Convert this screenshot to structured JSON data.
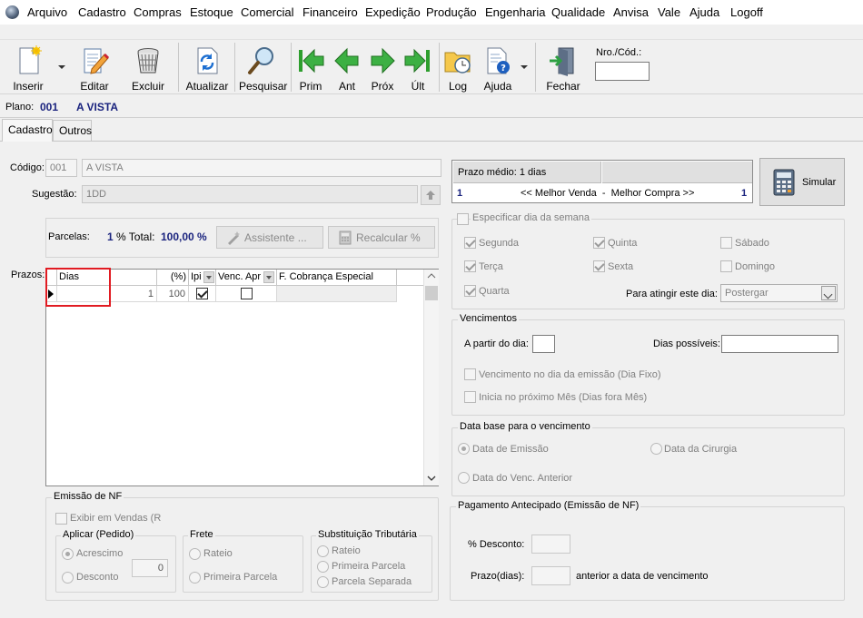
{
  "menu": [
    "Arquivo",
    "Cadastro",
    "Compras",
    "Estoque",
    "Comercial",
    "Financeiro",
    "Expedição",
    "Produção",
    "Engenharia",
    "Qualidade",
    "Anvisa",
    "Vale",
    "Ajuda",
    "Logoff"
  ],
  "toolbar": {
    "inserir": "Inserir",
    "editar": "Editar",
    "excluir": "Excluir",
    "atualizar": "Atualizar",
    "pesquisar": "Pesquisar",
    "prim": "Prim",
    "ant": "Ant",
    "prox": "Próx",
    "ult": "Últ",
    "log": "Log",
    "ajuda": "Ajuda",
    "fechar": "Fechar",
    "nro_label": "Nro./Cód.:",
    "nro_value": ""
  },
  "plano": {
    "label": "Plano:",
    "code": "001",
    "name": "A VISTA"
  },
  "tabs": [
    "Cadastro",
    "Outros"
  ],
  "form": {
    "codigo_label": "Código:",
    "codigo_value": "001",
    "descricao_value": "A VISTA",
    "sugestao_label": "Sugestão:",
    "sugestao_value": "1DD",
    "parcelas_label": "Parcelas:",
    "parcelas_value": "1",
    "total_label": "% Total:",
    "total_value": "100,00 %",
    "assistente": "Assistente ...",
    "recalcular": "Recalcular %",
    "prazos_label": "Prazos:"
  },
  "grid": {
    "headers": [
      "Dias",
      "(%)",
      "Ipi",
      "Venc. Apr",
      "F. Cobrança Especial"
    ],
    "rows": [
      {
        "dias": "1",
        "pct": "100",
        "ipi": true,
        "venc": false,
        "cobranca": ""
      }
    ]
  },
  "prazo_medio": {
    "label": "Prazo médio: 1 dias",
    "left": "1",
    "center": "<< Melhor Venda  -  Melhor Compra >>",
    "right": "1"
  },
  "simular": "Simular",
  "dias_semana": {
    "title": "Especificar dia da semana",
    "days": [
      "Segunda",
      "Quinta",
      "Sábado",
      "Terça",
      "Sexta",
      "Domingo",
      "Quarta"
    ],
    "atingir_label": "Para atingir este dia:",
    "atingir_value": "Postergar"
  },
  "vencimentos": {
    "title": "Vencimentos",
    "a_partir": "A partir do dia:",
    "dias_possiveis": "Dias possíveis:",
    "fixo": "Vencimento no dia da emissão (Dia Fixo)",
    "fora_mes": "Inicia no próximo Mês (Dias fora Mês)"
  },
  "data_base": {
    "title": "Data base para o vencimento",
    "emissao": "Data de Emissão",
    "cirurgia": "Data da Cirurgia",
    "venc_anterior": "Data do Venc. Anterior"
  },
  "emissao_nf": {
    "title": "Emissão de NF",
    "exibir": "Exibir em Vendas (R",
    "aplicar_title": "Aplicar (Pedido)",
    "acrescimo": "Acrescimo",
    "desconto": "Desconto",
    "valor": "0",
    "frete_title": "Frete",
    "rateio": "Rateio",
    "primeira": "Primeira Parcela",
    "st_title": "Substituição Tributária",
    "st_rateio": "Rateio",
    "st_primeira": "Primeira Parcela",
    "st_separada": "Parcela Separada"
  },
  "pagamento": {
    "title": "Pagamento Antecipado (Emissão de NF)",
    "desconto": "% Desconto:",
    "prazo": "Prazo(dias):",
    "anterior": "anterior a data de vencimento"
  },
  "colors": {
    "accent": "#1a237e",
    "highlight": "#e11b22"
  }
}
